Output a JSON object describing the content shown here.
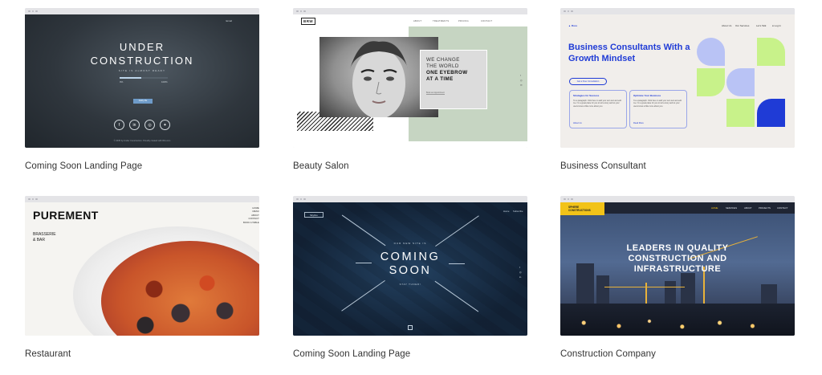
{
  "templates": [
    {
      "caption": "Coming Soon Landing Page",
      "preview": {
        "top_link": "Email",
        "title_line1": "UNDER",
        "title_line2": "CONSTRUCTION",
        "subtitle": "SITE IS ALMOST READY",
        "progress_left": "0%",
        "progress_right": "100%",
        "progress": 0.45,
        "button_label": "Notify Me",
        "social_icons": [
          "f",
          "in",
          "◎",
          "✦"
        ],
        "footer": "© 2035 by Under Construction. Proudly created with Wix.com"
      }
    },
    {
      "caption": "Beauty Salon",
      "preview": {
        "logo": "BRW",
        "nav": [
          "ABOUT",
          "TREATMENTS",
          "PRICING",
          "CONTACT"
        ],
        "headline": [
          "WE CHANGE",
          "THE WORLD",
          "ONE EYEBROW",
          "AT A TIME"
        ],
        "link": "Book an Appointment",
        "side_icons": [
          "f",
          "◎",
          "✉"
        ]
      }
    },
    {
      "caption": "Business Consultant",
      "preview": {
        "logo": "Ross",
        "nav": [
          "About Us",
          "Our Services",
          "Let's Talk",
          "Log In"
        ],
        "headline": "Business Consultants With a Growth Mindset",
        "cta": "Get a Free Consultation",
        "cards": [
          {
            "title": "Strategies for Success",
            "text": "I'm a paragraph. Click here to add your own text and edit me. I'm a great place for you to tell a story and let your users know a little more about you.",
            "link": "About Us"
          },
          {
            "title": "Optimize Your Business",
            "text": "I'm a paragraph. Click here to add your own text and edit me. I'm a great place for you to tell a story and let your users know a little more about you.",
            "link": "Read More"
          }
        ],
        "colors": {
          "blue": "#1f3bd6",
          "lime": "#c8f28a",
          "lavender": "#b9c3f5"
        }
      }
    },
    {
      "caption": "Restaurant",
      "preview": {
        "brand": "PUREMENT",
        "tagline": [
          "BRASSERIE",
          "& BAR"
        ],
        "menu": [
          "HOME",
          "MENU",
          "ABOUT",
          "CONTACT",
          "BOOK A TABLE"
        ]
      }
    },
    {
      "caption": "Coming Soon Landing Page",
      "preview": {
        "logo": "Skyline",
        "nav": [
          "Home",
          "Subscribe"
        ],
        "kicker": "OUR NEW SITE IS",
        "title_line1": "COMING",
        "title_line2": "SOON",
        "stay_tuned": "STAY TUNED!",
        "side_icons": [
          "f",
          "◎",
          "in"
        ],
        "scroll_icon": "↓"
      }
    },
    {
      "caption": "Construction Company",
      "preview": {
        "logo": [
          "SPHERE",
          "CONSTRUCTIONS"
        ],
        "nav": [
          "HOME",
          "SERVICES",
          "ABOUT",
          "PROJECTS",
          "CONTACT"
        ],
        "headline": [
          "LEADERS IN QUALITY",
          "CONSTRUCTION AND",
          "INFRASTRUCTURE"
        ],
        "colors": {
          "accent": "#f2c318"
        }
      }
    }
  ]
}
